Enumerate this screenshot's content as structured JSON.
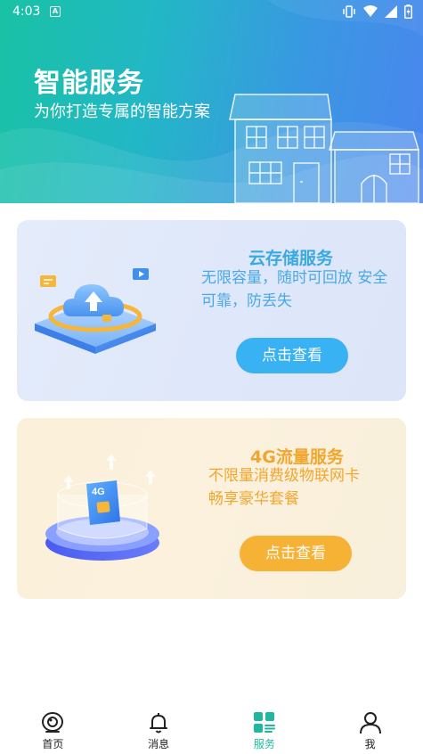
{
  "status_bar": {
    "time": "4:03",
    "notification_badge": "A",
    "icons": [
      "vibrate-icon",
      "wifi-icon",
      "signal-icon",
      "battery-icon"
    ]
  },
  "hero": {
    "title": "智能服务",
    "subtitle": "为你打造专属的智能方案"
  },
  "cards": [
    {
      "title": "云存储服务",
      "description": "无限容量，随时可回放 安全可靠，防丢失",
      "button_label": "点击查看",
      "accent": "#3aa9e3",
      "button_color": "#38b2f2"
    },
    {
      "title": "4G流量服务",
      "description_line1": "不限量消费级物联网卡",
      "description_line2": "畅享豪华套餐",
      "chip_label": "4G",
      "button_label": "点击查看",
      "accent": "#f2a62d",
      "button_color": "#f5b235"
    }
  ],
  "bottom_nav": {
    "items": [
      {
        "label": "首页",
        "icon": "camera-icon"
      },
      {
        "label": "消息",
        "icon": "bell-icon"
      },
      {
        "label": "服务",
        "icon": "service-grid-icon",
        "active": true
      },
      {
        "label": "我",
        "icon": "person-icon"
      }
    ],
    "active_color": "#1fb89e"
  }
}
